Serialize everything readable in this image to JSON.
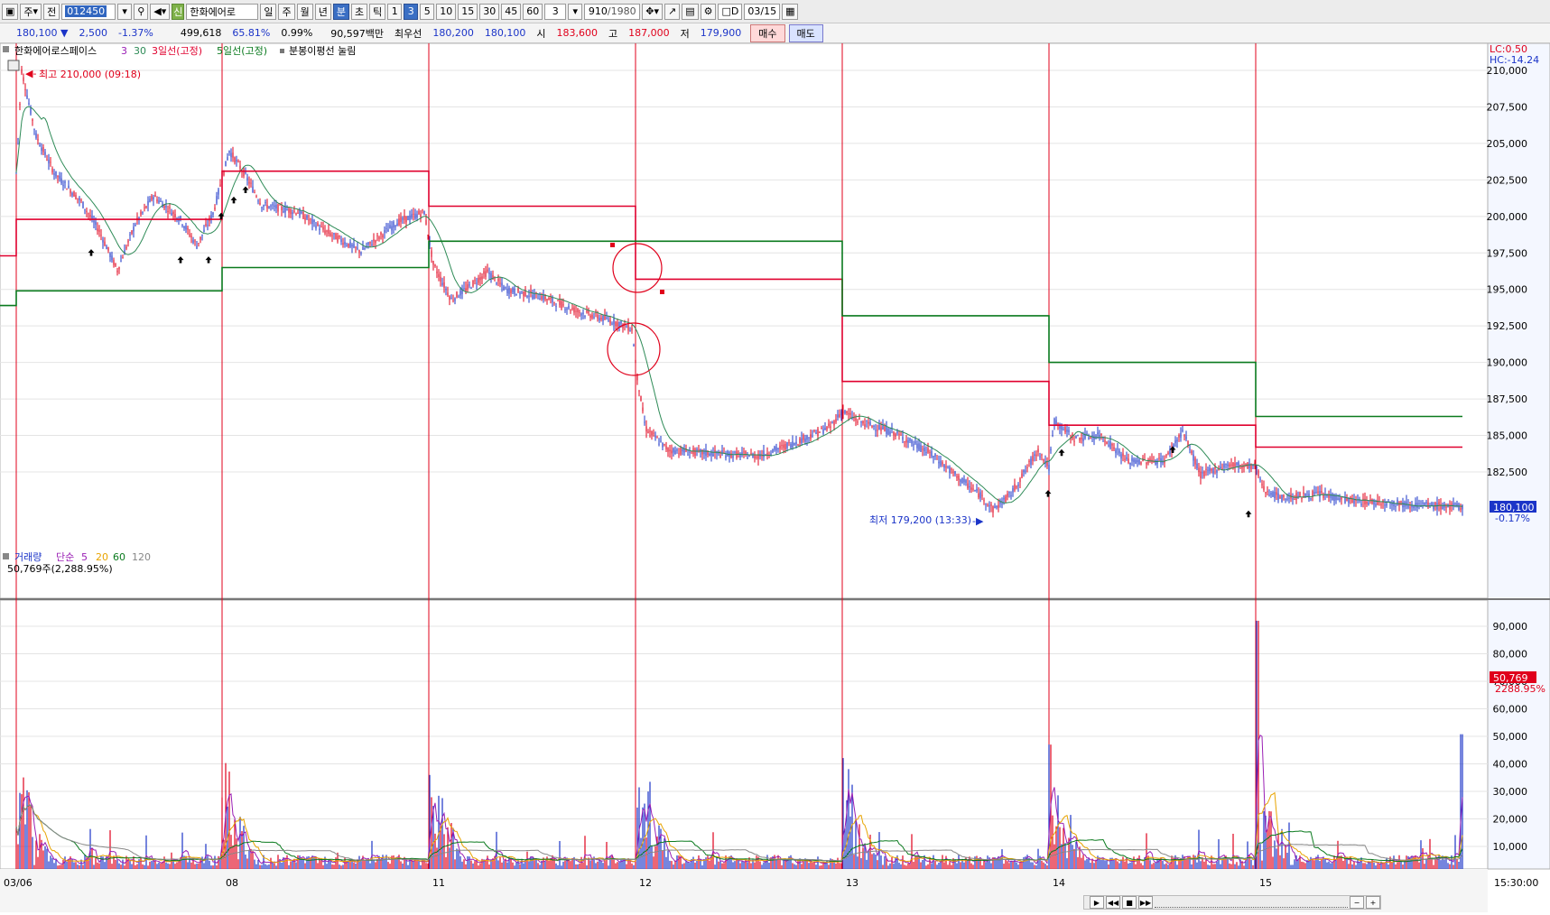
{
  "toolbar": {
    "market": "주",
    "scope": "전",
    "code": "012450",
    "shin": "신",
    "name": "한화에어로",
    "periods": [
      "일",
      "주",
      "월",
      "년",
      "분",
      "초",
      "틱"
    ],
    "minutes": [
      "1",
      "3",
      "5",
      "10",
      "15",
      "30",
      "45",
      "60"
    ],
    "interval_value": "3",
    "count": "910",
    "count_total": "/1980",
    "d_label": "D",
    "date": "03/15"
  },
  "quote": {
    "price": "180,100",
    "change": "2,500",
    "change_pct": "-1.37%",
    "volume": "499,618",
    "vol_ratio": "65.81%",
    "turnover": "0.99%",
    "amount": "90,597백만",
    "best_label": "최우선",
    "best_ask": "180,200",
    "best_bid": "180,100",
    "open_label": "시",
    "open": "183,600",
    "high_label": "고",
    "high": "187,000",
    "low_label": "저",
    "low": "179,900",
    "buy": "매수",
    "sell": "매도"
  },
  "price_panel": {
    "legend": {
      "name": "한화에어로스페이스",
      "ma3": "3",
      "ma30": "30",
      "line3": "3일선(고정)",
      "line5": "5일선(고정)",
      "extra": "분봉이평선 눌림"
    },
    "lc": "LC:0.50",
    "hc": "HC:-14.24",
    "high_annot": "최고 210,000 (09:18)",
    "low_annot": "최저 179,200 (13:33)",
    "current_price": "180,100",
    "current_pct": "-0.17%",
    "yticks": [
      "210,000",
      "207,500",
      "205,000",
      "202,500",
      "200,000",
      "197,500",
      "195,000",
      "192,500",
      "190,000",
      "187,500",
      "185,000",
      "182,500"
    ]
  },
  "volume_panel": {
    "legend": {
      "title": "거래량",
      "simple": "단순",
      "m5": "5",
      "m20": "20",
      "m60": "60",
      "m120": "120"
    },
    "info": "50,769주(2,288.95%)",
    "current_vol": "50,769",
    "current_pct": "2288.95%",
    "yticks": [
      "90,000",
      "80,000",
      "70,000",
      "60,000",
      "50,000",
      "40,000",
      "30,000",
      "20,000",
      "10,000"
    ]
  },
  "xaxis": {
    "labels": [
      "03/06",
      "08",
      "11",
      "12",
      "13",
      "14",
      "15"
    ],
    "time": "15:30:00"
  },
  "colors": {
    "candle_up": "#e0001b",
    "candle_down": "#1b34c8",
    "ma_line": "#2e8b57",
    "line3": "#e0002e",
    "line5": "#0a7a1e"
  },
  "chart_data": {
    "type": "line",
    "title": "",
    "series": [
      {
        "name": "3일선(고정)",
        "x": [
          "03/06",
          "08",
          "11",
          "12",
          "13",
          "14",
          "15"
        ],
        "values": [
          199800,
          203100,
          200700,
          195700,
          188700,
          185700,
          184200
        ]
      },
      {
        "name": "5일선(고정)",
        "x": [
          "03/06",
          "08",
          "11",
          "12",
          "13",
          "14",
          "15"
        ],
        "values": [
          194900,
          196500,
          198300,
          198300,
          193200,
          190000,
          186300
        ]
      }
    ],
    "price_path": {
      "x": [
        "03/06 09:00",
        "03/06 09:18",
        "03/08 09:00",
        "03/08 15:30",
        "03/11 09:30",
        "03/11 15:30",
        "03/12 09:30",
        "03/12 15:30",
        "03/13 09:30",
        "03/13 15:30",
        "03/14 09:30",
        "03/15 09:30",
        "03/15 15:30"
      ],
      "values": [
        203000,
        210000,
        197300,
        200300,
        196300,
        193000,
        183800,
        183800,
        186700,
        180700,
        185200,
        181300,
        180100
      ]
    },
    "ylim": [
      178000,
      212000
    ]
  }
}
